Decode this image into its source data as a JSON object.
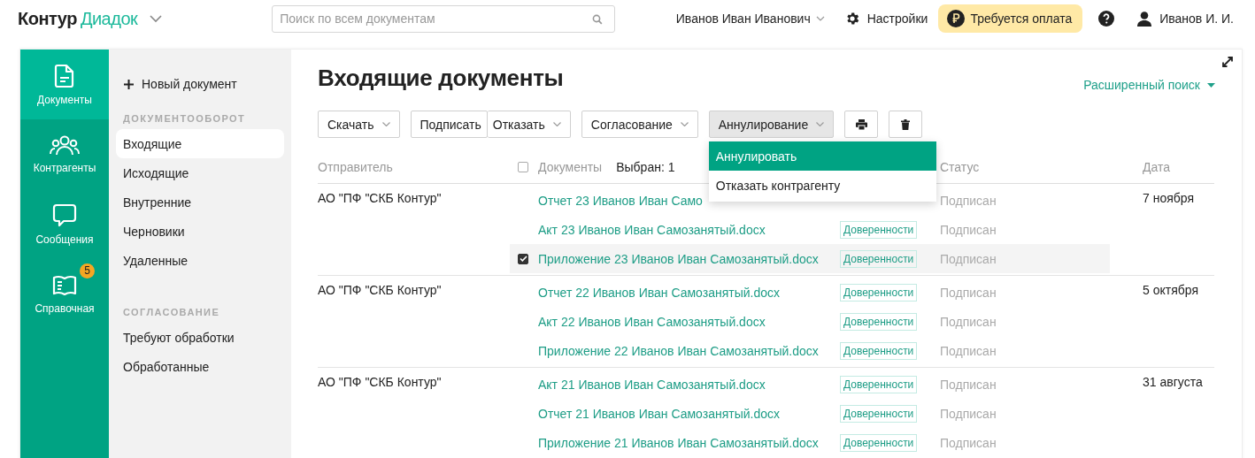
{
  "header": {
    "logo_main": "Контур",
    "logo_product": "Диадок",
    "search": {
      "placeholder": "Поиск по всем документам"
    },
    "org": "Иванов Иван Иванович",
    "settings": "Настройки",
    "payment": "Требуется оплата",
    "user": "Иванов И. И."
  },
  "rail": [
    {
      "label": "Документы",
      "selected": true
    },
    {
      "label": "Контрагенты",
      "selected": false
    },
    {
      "label": "Сообщения",
      "selected": false
    },
    {
      "label": "Справочная",
      "selected": false,
      "badge": "5"
    }
  ],
  "sidebar": {
    "new_document": "Новый документ",
    "sections": [
      {
        "heading": "ДОКУМЕНТООБОРОТ",
        "items": [
          {
            "label": "Входящие",
            "selected": true
          },
          {
            "label": "Исходящие",
            "selected": false
          },
          {
            "label": "Внутренние",
            "selected": false
          },
          {
            "label": "Черновики",
            "selected": false
          },
          {
            "label": "Удаленные",
            "selected": false
          }
        ]
      },
      {
        "heading": "СОГЛАСОВАНИЕ",
        "items": [
          {
            "label": "Требуют обработки",
            "selected": false
          },
          {
            "label": "Обработанные",
            "selected": false
          }
        ]
      }
    ]
  },
  "page": {
    "title": "Входящие документы",
    "advanced_search": "Расширенный поиск"
  },
  "toolbar": [
    {
      "kind": "dropdown",
      "label": "Скачать",
      "open": false
    },
    {
      "kind": "split",
      "parts": [
        {
          "kind": "plain",
          "label": "Подписать"
        },
        {
          "kind": "dropdown",
          "label": "Отказать"
        }
      ]
    },
    {
      "kind": "dropdown",
      "label": "Согласование",
      "open": false
    },
    {
      "kind": "dropdown",
      "label": "Аннулирование",
      "open": true
    },
    {
      "kind": "print"
    },
    {
      "kind": "delete"
    }
  ],
  "menu": [
    {
      "label": "Аннулировать",
      "selected": true
    },
    {
      "label": "Отказать контрагенту",
      "selected": false
    }
  ],
  "table": {
    "columns": {
      "sender": "Отправитель",
      "documents": "Документы",
      "selected_count": "Выбран: 1",
      "status": "Статус",
      "date": "Дата"
    },
    "select_all_checked": false,
    "groups": [
      {
        "sender": "АО \"ПФ \"СКБ Контур\"",
        "date": "7 ноября",
        "docs": [
          {
            "name": "Отчет 23  Иванов Иван Само",
            "status": "Подписан",
            "selected": false
          },
          {
            "name": "Акт 23 Иванов Иван Самозанятый.docx",
            "tag": "Доверенности",
            "status": "Подписан",
            "selected": false
          },
          {
            "name": "Приложение 23 Иванов Иван Самозанятый.docx",
            "tag": "Доверенности",
            "status": "Подписан",
            "selected": true
          }
        ]
      },
      {
        "sender": "АО \"ПФ \"СКБ Контур\"",
        "date": "5 октября",
        "docs": [
          {
            "name": "Отчет 22 Иванов Иван Самозанятый.docx",
            "tag": "Доверенности",
            "status": "Подписан",
            "selected": false
          },
          {
            "name": "Акт 22 Иванов Иван Самозанятый.docx",
            "tag": "Доверенности",
            "status": "Подписан",
            "selected": false
          },
          {
            "name": "Приложение 22 Иванов Иван Самозанятый.docx",
            "tag": "Доверенности",
            "status": "Подписан",
            "selected": false
          }
        ]
      },
      {
        "sender": "АО \"ПФ \"СКБ Контур\"",
        "date": "31 августа",
        "docs": [
          {
            "name": "Акт 21 Иванов Иван Самозанятый.docx",
            "tag": "Доверенности",
            "status": "Подписан",
            "selected": false
          },
          {
            "name": "Отчет 21 Иванов Иван Самозанятый.docx",
            "tag": "Доверенности",
            "status": "Подписан",
            "selected": false
          },
          {
            "name": "Приложение 21 Иванов Иван Самозанятый.docx",
            "tag": "Доверенности",
            "status": "Подписан",
            "selected": false
          }
        ]
      }
    ]
  }
}
